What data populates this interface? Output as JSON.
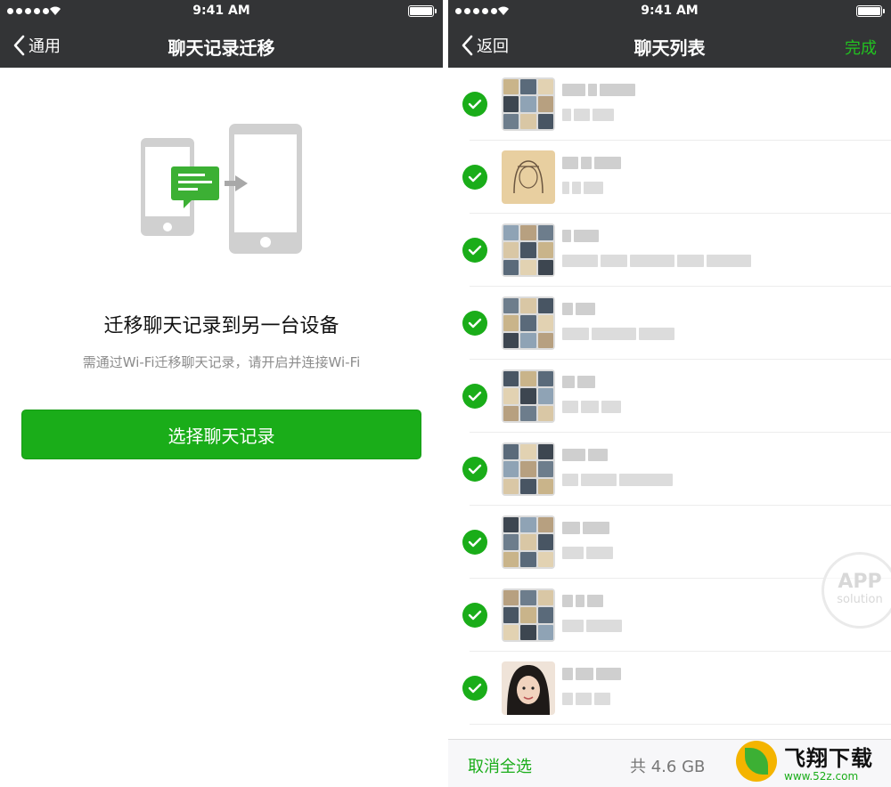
{
  "statusbar": {
    "time": "9:41 AM"
  },
  "left": {
    "nav": {
      "back_label": "通用",
      "title": "聊天记录迁移"
    },
    "heading": "迁移聊天记录到另一台设备",
    "subtitle": "需通过Wi-Fi迁移聊天记录，请开启并连接Wi-Fi",
    "primary_button": "选择聊天记录"
  },
  "right": {
    "nav": {
      "back_label": "返回",
      "title": "聊天列表",
      "done_label": "完成"
    },
    "rows": [
      {
        "checked": true,
        "avatar": "group-grid"
      },
      {
        "checked": true,
        "avatar": "sketch-portrait"
      },
      {
        "checked": true,
        "avatar": "group-grid"
      },
      {
        "checked": true,
        "avatar": "group-grid"
      },
      {
        "checked": true,
        "avatar": "group-grid"
      },
      {
        "checked": true,
        "avatar": "group-grid"
      },
      {
        "checked": true,
        "avatar": "group-grid"
      },
      {
        "checked": true,
        "avatar": "group-grid"
      },
      {
        "checked": true,
        "avatar": "photo-portrait"
      }
    ],
    "bottom": {
      "cancel_all_label": "取消全选",
      "total_size": "共 4.6 GB"
    }
  },
  "watermark": {
    "line1": "APP",
    "line2": "solution"
  },
  "logo": {
    "title": "飞翔下载",
    "url": "www.52z.com"
  },
  "colors": {
    "accent": "#1aad19",
    "nav_bg": "#333436"
  }
}
